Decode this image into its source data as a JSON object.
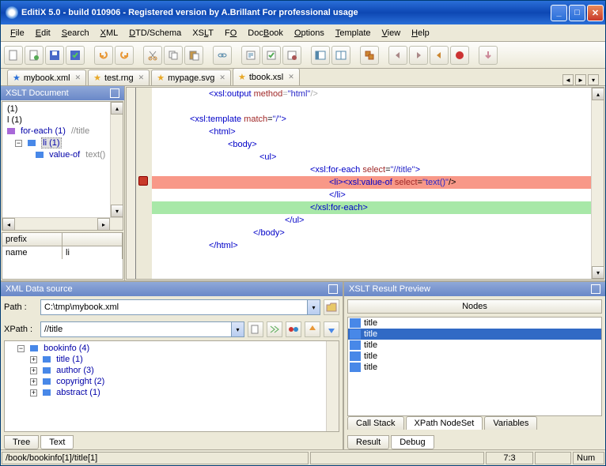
{
  "window": {
    "title": "EditiX 5.0 - build 010906 - Registered version by A.Brillant For professional usage"
  },
  "menu": [
    "File",
    "Edit",
    "Search",
    "XML",
    "DTD/Schema",
    "XSLT",
    "FO",
    "DocBook",
    "Options",
    "Template",
    "View",
    "Help"
  ],
  "menu_underline_index": [
    0,
    0,
    0,
    0,
    0,
    2,
    1,
    3,
    0,
    0,
    0,
    0
  ],
  "toolbar_icons": [
    "new-file",
    "new-doc",
    "save",
    "save-check",
    "undo",
    "redo",
    "cut",
    "copy",
    "paste",
    "link",
    "format",
    "validate",
    "tree-view",
    "side-view",
    "columns",
    "refresh",
    "nav-back",
    "nav-fwd",
    "stop-red",
    "stop-orange",
    "run"
  ],
  "tabs": [
    {
      "label": "mybook.xml",
      "star": "blue"
    },
    {
      "label": "test.rng",
      "star": "yellow"
    },
    {
      "label": "mypage.svg",
      "star": "yellow"
    },
    {
      "label": "tbook.xsl",
      "star": "yellow",
      "active": true
    }
  ],
  "xslt_panel_title": "XSLT Document",
  "tree_top": {
    "n0": "(1)",
    "n1": "l (1)",
    "n2": "for-each (1)",
    "n2_extra": "//title",
    "n3": "li",
    "n3_count": "(1)",
    "n4": "value-of",
    "n4_extra": "text()"
  },
  "grid": {
    "h0": "prefix",
    "h1": "",
    "r0c0": "name",
    "r0c1": "li"
  },
  "code": {
    "l0": {
      "pre": "<xsl:output ",
      "attr": "method",
      "eq": "=\"",
      "val": "html",
      "post": "\"/>"
    },
    "l1": {
      "pre": "<xsl:template ",
      "attr": "match",
      "eq": "=\"",
      "val": "/",
      "post": "\">"
    },
    "l2": "<html>",
    "l3": "<body>",
    "l4": "<ul>",
    "l5": {
      "pre": "<xsl:for-each ",
      "attr": "select",
      "eq": "=\"",
      "val": "//title",
      "post": "\">"
    },
    "l6": {
      "open": "<li>",
      "mid": "<xsl:value-of ",
      "attr": "select",
      "eq": "=\"",
      "val": "text()",
      "post": "\"/>"
    },
    "l7": "</li>",
    "l8": "</xsl:for-each>",
    "l9": "</ul>",
    "l10": "</body>",
    "l11": "</html>"
  },
  "datasource": {
    "title": "XML Data source",
    "path_label": "Path :",
    "path_value": "C:\\tmp\\mybook.xml",
    "xpath_label": "XPath :",
    "xpath_value": "//title",
    "tree": {
      "n0": "bookinfo (4)",
      "n1": "title (1)",
      "n2": "author (3)",
      "n3": "copyright (2)",
      "n4": "abstract (1)"
    },
    "tabs": [
      "Tree",
      "Text"
    ]
  },
  "result": {
    "title": "XSLT Result Preview",
    "header": "Nodes",
    "rows": [
      "title",
      "title",
      "title",
      "title",
      "title"
    ],
    "selected": 1,
    "toptabs": [
      "Call Stack",
      "XPath NodeSet",
      "Variables"
    ],
    "bottomtabs": [
      "Result",
      "Debug"
    ]
  },
  "status": {
    "path": "/book/bookinfo[1]/title[1]",
    "pos": "7:3",
    "num": "Num"
  }
}
